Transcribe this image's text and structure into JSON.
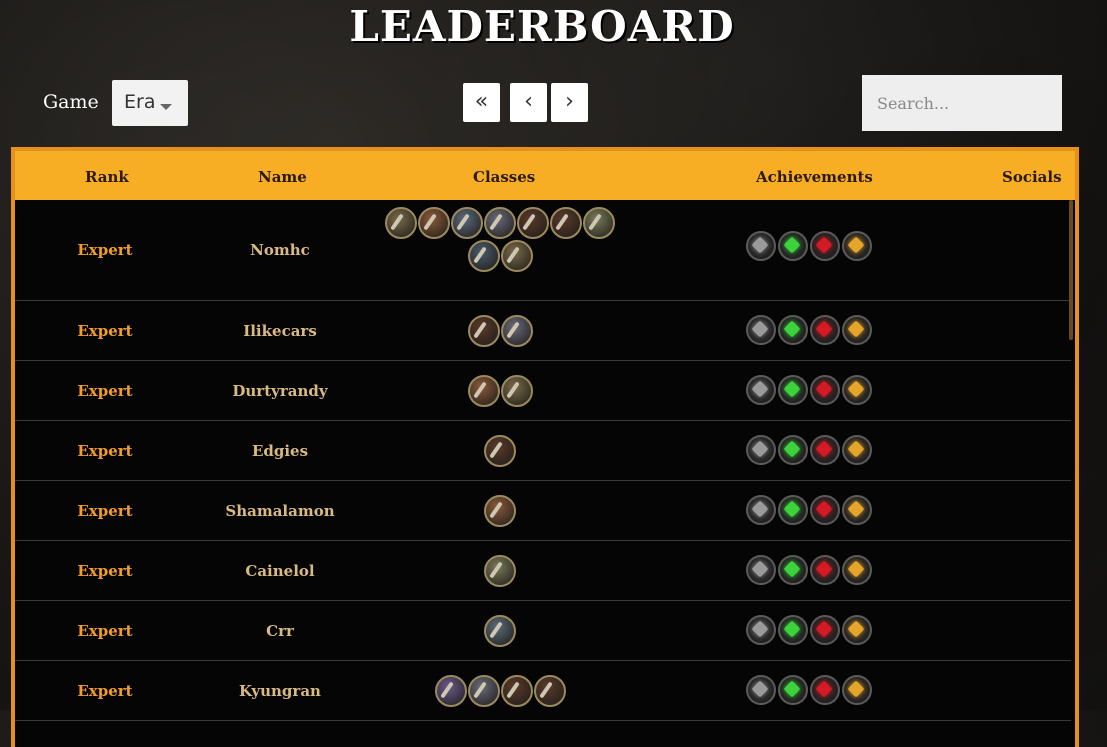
{
  "header": {
    "title": "LEADERBOARD"
  },
  "filters": {
    "game_label": "Game",
    "game_selected": "Era",
    "search_placeholder": "Search..."
  },
  "pager": {
    "first": "«",
    "prev": "‹",
    "next": "›"
  },
  "table": {
    "columns": {
      "rank": "Rank",
      "name": "Name",
      "classes": "Classes",
      "achievements": "Achievements",
      "socials": "Socials"
    },
    "rows": [
      {
        "rank": "Expert",
        "name": "Nomhc",
        "classes": [
          "warrior",
          "druid",
          "rogue",
          "priest",
          "hunter",
          "hunter",
          "mage",
          "warlock",
          "warrior"
        ],
        "achievements": [
          "silver",
          "green",
          "red",
          "gold"
        ]
      },
      {
        "rank": "Expert",
        "name": "Ilikecars",
        "classes": [
          "hunter",
          "priest"
        ],
        "achievements": [
          "silver",
          "green",
          "red",
          "gold"
        ]
      },
      {
        "rank": "Expert",
        "name": "Durtyrandy",
        "classes": [
          "druid",
          "warrior"
        ],
        "achievements": [
          "silver",
          "green",
          "red",
          "gold"
        ]
      },
      {
        "rank": "Expert",
        "name": "Edgies",
        "classes": [
          "hunter"
        ],
        "achievements": [
          "silver",
          "green",
          "red",
          "gold"
        ]
      },
      {
        "rank": "Expert",
        "name": "Shamalamon",
        "classes": [
          "druid"
        ],
        "achievements": [
          "silver",
          "green",
          "red",
          "gold"
        ]
      },
      {
        "rank": "Expert",
        "name": "Cainelol",
        "classes": [
          "mage"
        ],
        "achievements": [
          "silver",
          "green",
          "red",
          "gold"
        ]
      },
      {
        "rank": "Expert",
        "name": "Crr",
        "classes": [
          "rogue"
        ],
        "achievements": [
          "silver",
          "green",
          "red",
          "gold"
        ]
      },
      {
        "rank": "Expert",
        "name": "Kyungran",
        "classes": [
          "shaman",
          "priest",
          "hunter",
          "hunter"
        ],
        "achievements": [
          "silver",
          "green",
          "red",
          "gold"
        ]
      }
    ]
  },
  "colors": {
    "header_bg": "#f8ae24",
    "border": "#e6901e",
    "rank_text": "#f29d2a",
    "name_text": "#d9ba82",
    "achievement_silver": "#9a9a9a",
    "achievement_green": "#3bd23b",
    "achievement_red": "#d41a24",
    "achievement_gold": "#e5a52a"
  }
}
